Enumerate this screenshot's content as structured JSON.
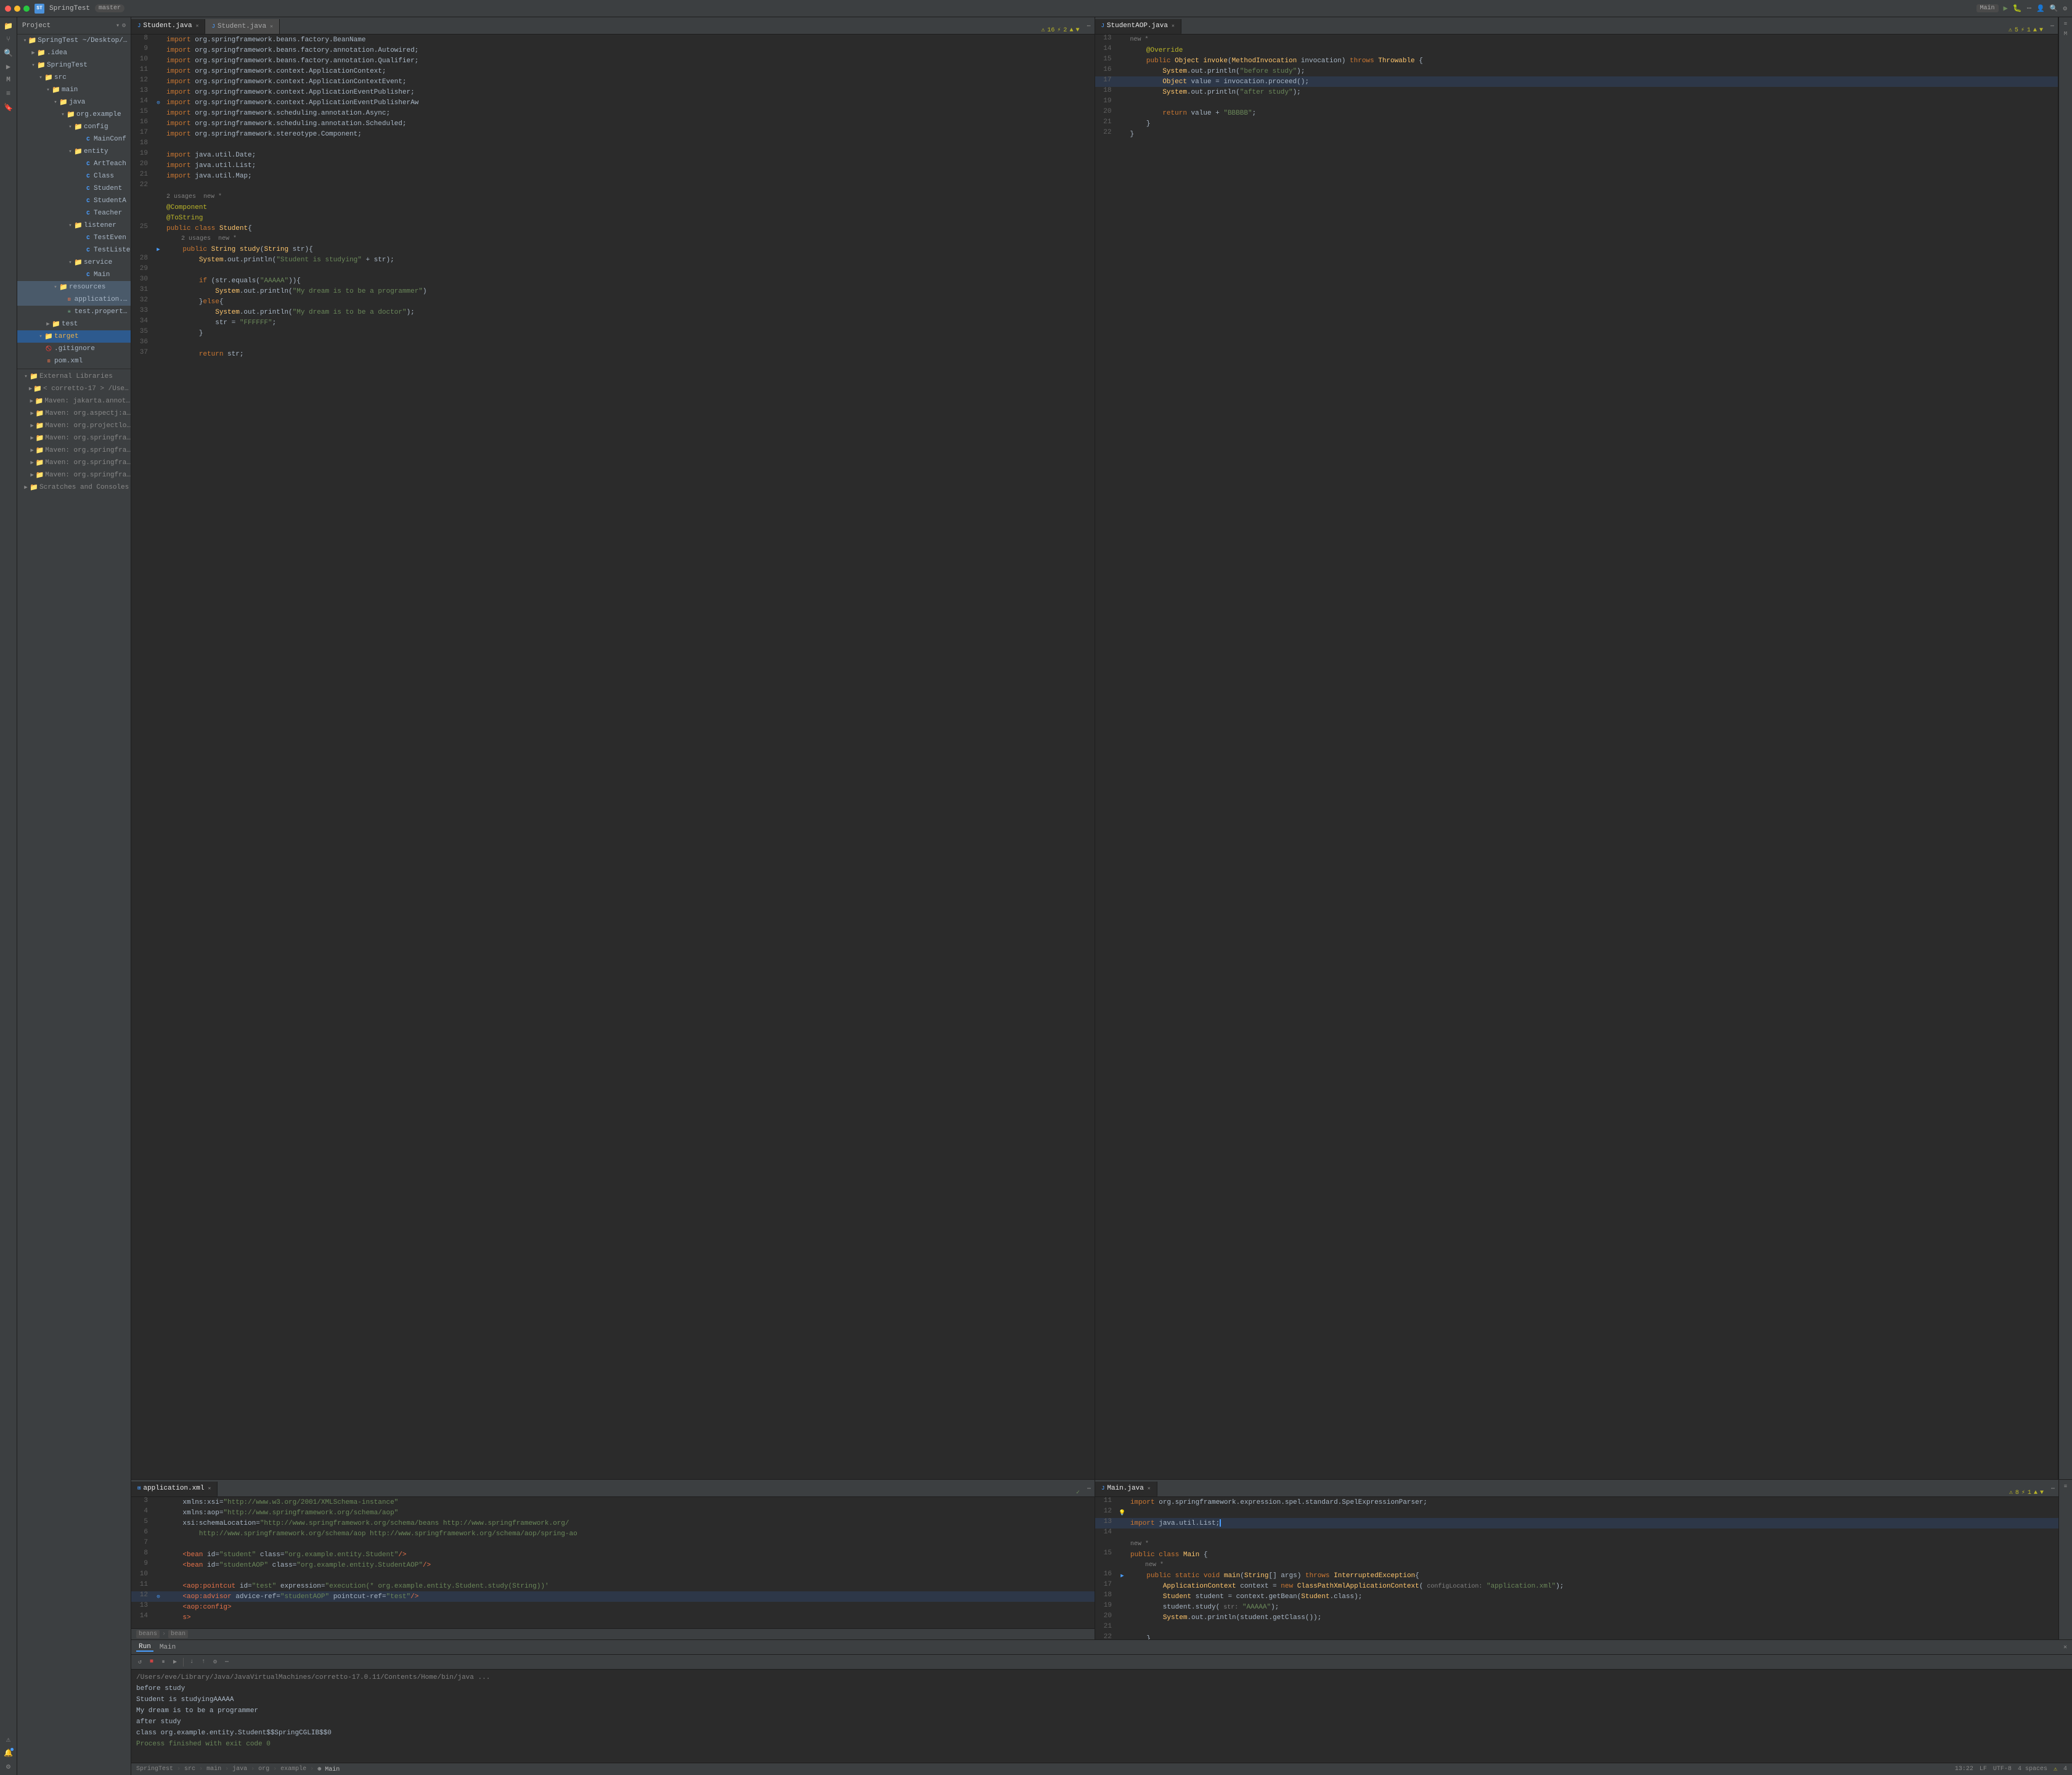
{
  "titleBar": {
    "appName": "SpringTest",
    "branch": "master",
    "windowButtons": [
      "close",
      "minimize",
      "maximize"
    ],
    "actions": [
      "Main",
      "run",
      "debug",
      "more",
      "profile",
      "search",
      "settings"
    ]
  },
  "leftIcons": [
    {
      "name": "folder-icon",
      "symbol": "📁",
      "active": false
    },
    {
      "name": "git-icon",
      "symbol": "⑂",
      "active": false
    },
    {
      "name": "find-icon",
      "symbol": "🔍",
      "active": false
    },
    {
      "name": "run-icon",
      "symbol": "▶",
      "active": false
    },
    {
      "name": "maven-icon",
      "symbol": "M",
      "active": false
    },
    {
      "name": "structure-icon",
      "symbol": "≡",
      "active": false
    },
    {
      "name": "bookmark-icon",
      "symbol": "🔖",
      "active": false
    },
    {
      "name": "database-icon",
      "symbol": "🗄",
      "active": false
    }
  ],
  "projectPanel": {
    "title": "Project",
    "items": [
      {
        "id": "springtest-root",
        "label": "SpringTest ~/Desktop/CS/...",
        "indent": 0,
        "type": "folder",
        "expanded": true
      },
      {
        "id": "idea",
        "label": ".idea",
        "indent": 1,
        "type": "folder",
        "expanded": false
      },
      {
        "id": "springtest-sub",
        "label": "SpringTest",
        "indent": 1,
        "type": "folder",
        "expanded": true
      },
      {
        "id": "src",
        "label": "src",
        "indent": 2,
        "type": "folder",
        "expanded": true
      },
      {
        "id": "main",
        "label": "main",
        "indent": 3,
        "type": "folder",
        "expanded": true
      },
      {
        "id": "java",
        "label": "java",
        "indent": 4,
        "type": "folder",
        "expanded": true
      },
      {
        "id": "org-example",
        "label": "org.example",
        "indent": 5,
        "type": "folder",
        "expanded": true
      },
      {
        "id": "config",
        "label": "config",
        "indent": 6,
        "type": "folder",
        "expanded": true
      },
      {
        "id": "mainconfig",
        "label": "MainConf",
        "indent": 7,
        "type": "java",
        "expanded": false
      },
      {
        "id": "entity",
        "label": "entity",
        "indent": 6,
        "type": "folder",
        "expanded": true
      },
      {
        "id": "artteacher",
        "label": "ArtTeach",
        "indent": 7,
        "type": "java",
        "expanded": false
      },
      {
        "id": "class",
        "label": "Class",
        "indent": 7,
        "type": "java",
        "expanded": false
      },
      {
        "id": "student",
        "label": "Student",
        "indent": 7,
        "type": "java",
        "expanded": false
      },
      {
        "id": "studentaop",
        "label": "StudentA",
        "indent": 7,
        "type": "java",
        "expanded": false
      },
      {
        "id": "teacher",
        "label": "Teacher",
        "indent": 7,
        "type": "java",
        "expanded": false
      },
      {
        "id": "listener",
        "label": "listener",
        "indent": 6,
        "type": "folder",
        "expanded": true
      },
      {
        "id": "testevent",
        "label": "TestEven",
        "indent": 7,
        "type": "java",
        "expanded": false
      },
      {
        "id": "testlistener",
        "label": "TestListe",
        "indent": 7,
        "type": "java",
        "expanded": false
      },
      {
        "id": "service",
        "label": "service",
        "indent": 6,
        "type": "folder",
        "expanded": true
      },
      {
        "id": "main-java",
        "label": "Main",
        "indent": 7,
        "type": "java",
        "expanded": false
      },
      {
        "id": "resources",
        "label": "resources",
        "indent": 4,
        "type": "folder",
        "expanded": true,
        "highlighted": true
      },
      {
        "id": "application-xml",
        "label": "application.xml",
        "indent": 5,
        "type": "xml",
        "expanded": false,
        "highlighted": true
      },
      {
        "id": "test-properties",
        "label": "test.properties",
        "indent": 5,
        "type": "props",
        "expanded": false
      },
      {
        "id": "test",
        "label": "test",
        "indent": 3,
        "type": "folder",
        "expanded": false
      },
      {
        "id": "target",
        "label": "target",
        "indent": 2,
        "type": "folder",
        "expanded": true,
        "selected": true
      },
      {
        "id": "gitignore",
        "label": ".gitignore",
        "indent": 2,
        "type": "file"
      },
      {
        "id": "pom",
        "label": "pom.xml",
        "indent": 2,
        "type": "xml"
      },
      {
        "id": "external-libs",
        "label": "External Libraries",
        "indent": 0,
        "type": "folder",
        "expanded": true
      },
      {
        "id": "corretto17",
        "label": "< corretto-17 > /Users/e...",
        "indent": 1,
        "type": "folder",
        "expanded": false
      },
      {
        "id": "maven-jakarta",
        "label": "Maven: jakarta.annotatio",
        "indent": 1,
        "type": "folder",
        "expanded": false
      },
      {
        "id": "maven-aspectj",
        "label": "Maven: org.aspectj:aspe",
        "indent": 1,
        "type": "folder",
        "expanded": false
      },
      {
        "id": "maven-projectlombo",
        "label": "Maven: org.projectlombo",
        "indent": 1,
        "type": "folder",
        "expanded": false
      },
      {
        "id": "maven-springframework1",
        "label": "Maven: org.springframew",
        "indent": 1,
        "type": "folder",
        "expanded": false
      },
      {
        "id": "maven-springframework2",
        "label": "Maven: org.springframew",
        "indent": 1,
        "type": "folder",
        "expanded": false
      },
      {
        "id": "maven-springframework3",
        "label": "Maven: org.springframew",
        "indent": 1,
        "type": "folder",
        "expanded": false
      },
      {
        "id": "maven-springframework4",
        "label": "Maven: org.springframew",
        "indent": 1,
        "type": "folder",
        "expanded": false
      },
      {
        "id": "scratches",
        "label": "Scratches and Consoles",
        "indent": 0,
        "type": "folder",
        "expanded": false
      }
    ]
  },
  "editors": {
    "topLeft": {
      "tabs": [
        {
          "id": "student-java",
          "label": "Student.java",
          "active": true
        },
        {
          "id": "student-java-dup",
          "label": "Student.java",
          "active": false
        }
      ],
      "lines": [
        {
          "num": 8,
          "code": "import org.springframework.beans.factory.BeanName",
          "gutter": ""
        },
        {
          "num": 9,
          "code": "import org.springframework.beans.factory.annotation.Autowired;",
          "gutter": ""
        },
        {
          "num": 10,
          "code": "import org.springframework.beans.factory.annotation.Qualifier;",
          "gutter": ""
        },
        {
          "num": 11,
          "code": "import org.springframework.context.ApplicationContext;",
          "gutter": ""
        },
        {
          "num": 12,
          "code": "import org.springframework.context.ApplicationContextEvent;",
          "gutter": ""
        },
        {
          "num": 13,
          "code": "import org.springframework.context.ApplicationEventPublisher;",
          "gutter": ""
        },
        {
          "num": 14,
          "code": "import org.springframework.context.ApplicationEventPublisherAw",
          "gutter": ""
        },
        {
          "num": 15,
          "code": "import org.springframework.scheduling.annotation.Async;",
          "gutter": ""
        },
        {
          "num": 16,
          "code": "import org.springframework.scheduling.annotation.Scheduled;",
          "gutter": ""
        },
        {
          "num": 17,
          "code": "import org.springframework.stereotype.Component;",
          "gutter": ""
        },
        {
          "num": 18,
          "code": "",
          "gutter": ""
        },
        {
          "num": 19,
          "code": "import java.util.Date;",
          "gutter": ""
        },
        {
          "num": 20,
          "code": "import java.util.List;",
          "gutter": ""
        },
        {
          "num": 21,
          "code": "import java.util.Map;",
          "gutter": ""
        },
        {
          "num": 22,
          "code": "",
          "gutter": ""
        },
        {
          "num": 23,
          "code": "2 usages  new *",
          "gutter": "",
          "meta": true
        },
        {
          "num": "",
          "code": "@Component",
          "gutter": "",
          "isAnnotation": true
        },
        {
          "num": "",
          "code": "@ToString",
          "gutter": "",
          "isAnnotation": true
        },
        {
          "num": 25,
          "code": "public class Student{",
          "gutter": ""
        },
        {
          "num": 26,
          "code": "    2 usages  new *",
          "gutter": "",
          "meta": true
        },
        {
          "num": "",
          "code": "    public String study(String str){",
          "gutter": "",
          "isMethod": true
        },
        {
          "num": 28,
          "code": "        System.out.println(\"Student is studying\" + str);",
          "gutter": ""
        },
        {
          "num": 29,
          "code": "",
          "gutter": ""
        },
        {
          "num": 30,
          "code": "        if (str.equals(\"AAAAA\")){",
          "gutter": ""
        },
        {
          "num": 31,
          "code": "            System.out.println(\"My dream is to be a programmer\")",
          "gutter": ""
        },
        {
          "num": 32,
          "code": "        }else{",
          "gutter": ""
        },
        {
          "num": 33,
          "code": "            System.out.println(\"My dream is to be a doctor\");",
          "gutter": ""
        },
        {
          "num": 34,
          "code": "            str = \"FFFFFF\";",
          "gutter": ""
        },
        {
          "num": 35,
          "code": "        }",
          "gutter": ""
        },
        {
          "num": 36,
          "code": "",
          "gutter": ""
        },
        {
          "num": 37,
          "code": "        return str;",
          "gutter": ""
        }
      ],
      "warnings": {
        "count": 16,
        "fixes": 2
      }
    },
    "topRight": {
      "tabs": [
        {
          "id": "studentaop-java",
          "label": "StudentAOP.java",
          "active": true
        }
      ],
      "lines": [
        {
          "num": 13,
          "code": "new *"
        },
        {
          "num": 14,
          "code": "    @Override"
        },
        {
          "num": 15,
          "code": "    public Object invoke(MethodInvocation invocation) throws Throwable {"
        },
        {
          "num": 16,
          "code": "        System.out.println(\"before study\");"
        },
        {
          "num": 17,
          "code": "        Object value = invocation.proceed();",
          "current": true
        },
        {
          "num": 18,
          "code": "        System.out.println(\"after study\");"
        },
        {
          "num": 19,
          "code": ""
        },
        {
          "num": 20,
          "code": "        return value + \"BBBBB\";"
        },
        {
          "num": 21,
          "code": "    }"
        },
        {
          "num": 22,
          "code": ""
        }
      ],
      "warnings": {
        "count": 5,
        "fixes": 1
      }
    },
    "bottomLeft": {
      "tabs": [
        {
          "id": "application-xml",
          "label": "application.xml",
          "active": true
        }
      ],
      "lines": [
        {
          "num": 3,
          "code": "    xmlns:xsi=\"http://www.w3.org/2001/XMLSchema-instance\""
        },
        {
          "num": 4,
          "code": "    xmlns:aop=\"http://www.springframework.org/schema/aop\""
        },
        {
          "num": 5,
          "code": "    xsi:schemaLocation=\"http://www.springframework.org/schema/beans http://www.springframework.org/"
        },
        {
          "num": 6,
          "code": "        http://www.springframework.org/schema/aop http://www.springframework.org/schema/aop/spring-ao"
        },
        {
          "num": 7,
          "code": ""
        },
        {
          "num": 8,
          "code": "    <bean id=\"student\" class=\"org.example.entity.Student\"/>"
        },
        {
          "num": 9,
          "code": "    <bean id=\"studentAOP\" class=\"org.example.entity.StudentAOP\"/>"
        },
        {
          "num": 10,
          "code": ""
        },
        {
          "num": 11,
          "code": "    <aop:pointcut id=\"test\" expression=\"execution(* org.example.entity.Student.study(String))"
        },
        {
          "num": 12,
          "code": "    <aop:advisor advice-ref=\"studentAOP\" pointcut-ref=\"test\"/>",
          "current": true
        },
        {
          "num": 13,
          "code": "    <aop:config>"
        },
        {
          "num": 14,
          "code": "    s>"
        }
      ],
      "statusTags": [
        "beans",
        "bean"
      ]
    },
    "bottomRight": {
      "tabs": [
        {
          "id": "main-java",
          "label": "Main.java",
          "active": true
        }
      ],
      "lines": [
        {
          "num": 11,
          "code": "import org.springframework.expression.spel.standard.SpelExpressionParser;"
        },
        {
          "num": 12,
          "code": "",
          "hasLight": true
        },
        {
          "num": 13,
          "code": "import java.util.List;",
          "hasCursor": true
        },
        {
          "num": 14,
          "code": ""
        },
        {
          "num": "",
          "code": "new *",
          "meta": true
        },
        {
          "num": 15,
          "code": "public class Main {"
        },
        {
          "num": "",
          "code": "    new *",
          "meta": true
        },
        {
          "num": 16,
          "code": "    public static void main(String[] args) throws InterruptedException{",
          "hasRun": true
        },
        {
          "num": 17,
          "code": "        ApplicationContext context = new ClassPathXmlApplicationContext( configLocation: \"application.xml\");"
        },
        {
          "num": 18,
          "code": "        Student student = context.getBean(Student.class);"
        },
        {
          "num": 19,
          "code": "        student.study( str: \"AAAAA\");"
        },
        {
          "num": 20,
          "code": "        System.out.println(student.getClass());"
        },
        {
          "num": 21,
          "code": ""
        },
        {
          "num": 22,
          "code": "    }"
        },
        {
          "num": 23,
          "code": "}"
        }
      ],
      "warnings": {
        "count": 8,
        "fixes": 1
      }
    }
  },
  "runPanel": {
    "tabs": [
      {
        "id": "run",
        "label": "Run",
        "active": true
      },
      {
        "id": "main",
        "label": "Main",
        "active": false
      }
    ],
    "toolbarButtons": [
      "rerun",
      "stop",
      "pause",
      "resume",
      "step-in",
      "step-out",
      "settings"
    ],
    "outputPath": "/Users/eve/Library/Java/JavaVirtualMachines/corretto-17.0.11/Contents/Home/bin/java ...",
    "outputLines": [
      {
        "text": "before study",
        "class": ""
      },
      {
        "text": "Student is studyingAAAAA",
        "class": ""
      },
      {
        "text": "My dream is to be a programmer",
        "class": ""
      },
      {
        "text": "after study",
        "class": ""
      },
      {
        "text": "class org.example.entity.Student$$SpringCGLIB$$0",
        "class": ""
      },
      {
        "text": "",
        "class": ""
      },
      {
        "text": "Process finished with exit code 0",
        "class": "green"
      }
    ]
  },
  "statusBar": {
    "breadcrumb": [
      "SpringTest",
      "src",
      "main",
      "java",
      "org",
      "example",
      "Main"
    ],
    "breadcrumbSeps": [
      ">",
      ">",
      ">",
      ">",
      ">",
      ">"
    ],
    "time": "13:22",
    "lineEnding": "LF",
    "encoding": "UTF-8",
    "indent": "4 spaces",
    "warnings": "4 spaces"
  }
}
